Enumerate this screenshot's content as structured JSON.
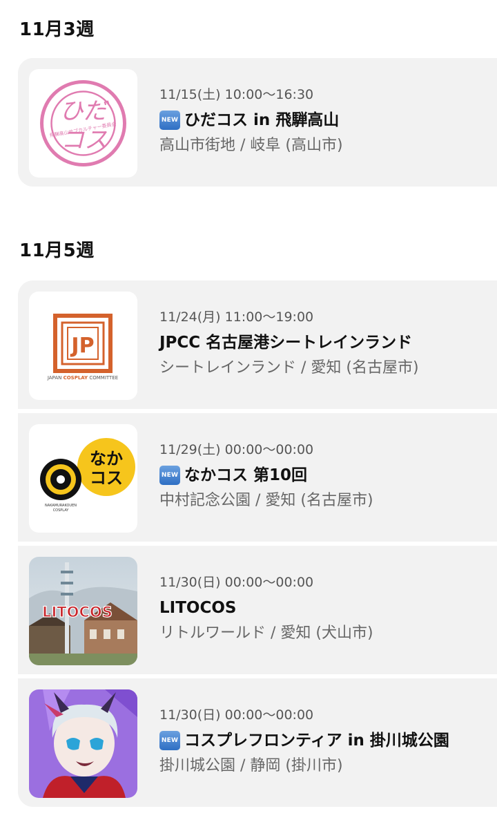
{
  "week_sections": [
    {
      "heading": "11月3週",
      "events": [
        {
          "date": "11/15(土) 10:00〜16:30",
          "is_new": true,
          "badge": "NEW",
          "title": "ひだコス in 飛騨高山",
          "venue": "高山市街地 / 岐阜 (高山市)",
          "logo": "hidakos-logo-icon"
        }
      ]
    },
    {
      "heading": "11月5週",
      "events": [
        {
          "date": "11/24(月) 11:00〜19:00",
          "is_new": false,
          "title": "JPCC 名古屋港シートレインランド",
          "venue": "シートレインランド / 愛知 (名古屋市)",
          "logo": "jpcc-logo-icon"
        },
        {
          "date": "11/29(土) 00:00〜00:00",
          "is_new": true,
          "badge": "NEW",
          "title": "なかコス 第10回",
          "venue": "中村記念公園 / 愛知 (名古屋市)",
          "logo": "nakakos-logo-icon"
        },
        {
          "date": "11/30(日) 00:00〜00:00",
          "is_new": false,
          "title": "LITOCOS",
          "venue": "リトルワールド / 愛知 (犬山市)",
          "logo": "litocos-photo-icon"
        },
        {
          "date": "11/30(日) 00:00〜00:00",
          "is_new": true,
          "badge": "NEW",
          "title": "コスプレフロンティア in 掛川城公園",
          "venue": "掛川城公園 / 静岡 (掛川市)",
          "logo": "cosplay-frontier-illustration-icon"
        }
      ]
    }
  ],
  "logos": {
    "hidakos": {
      "line1": "ひだ",
      "line2": "コス",
      "ring_text": "飛騨高山サブカルチャー委員会",
      "color": "#e07bb0"
    },
    "jpcc": {
      "mark": "JP",
      "caption_pre": "JAPAN ",
      "caption_mid": "COSPLAY",
      "caption_post": " COMMITTEE",
      "color": "#d4622c"
    },
    "nakakos": {
      "line1": "なか",
      "line2": "コス",
      "ring_line1": "NAKAMURAKOUEN",
      "ring_line2": "COSPLAY",
      "color": "#f6c51c"
    },
    "litocos": {
      "sign": "LITOCOS"
    }
  },
  "colors": {
    "card_bg": "#f2f2f2",
    "date": "#555555",
    "venue": "#666666",
    "new_badge": "#3f7fcf"
  }
}
